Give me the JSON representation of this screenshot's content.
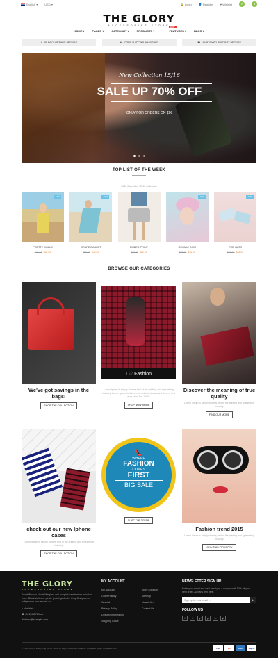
{
  "topbar": {
    "language": "English",
    "currency": "USD",
    "login": "Login",
    "register": "Register",
    "wishlist": "Wishlist"
  },
  "logo": {
    "name": "THE GLORY",
    "tagline": "ACCESSORIES STORE"
  },
  "nav": {
    "items": [
      "HOME",
      "PAGES",
      "CATEGORY",
      "PRODUCTS",
      "FEATURES",
      "BLOG"
    ],
    "hot_label": "HOT"
  },
  "services": [
    "30 DAYS RETURN SERVICE",
    "FREE SHIPPING ALL ORDER",
    "CUSTOMER SUPPORT SERVICE"
  ],
  "hero": {
    "kicker": "New Collection 15/16",
    "headline": "SALE UP 70% OFF",
    "subline": "ONLY FOR ORDERS ON $99"
  },
  "toplist": {
    "title": "TOP LIST OF THE WEEK",
    "tabs": "2015 Collection / 2016 Collection",
    "products": [
      {
        "name": "PRETTY DOLLS",
        "old": "$40.00",
        "price": "$30.00",
        "badge": "-10%"
      },
      {
        "name": "GRAPE BASKET",
        "old": "$50.00",
        "price": "$40.00",
        "badge": "-10%"
      },
      {
        "name": "EMBED PRINT",
        "old": "$30.00",
        "price": "$20.00",
        "badge": ""
      },
      {
        "name": "GEOMIC DICK",
        "old": "$25.00",
        "price": "$15.00",
        "badge": "-10%"
      },
      {
        "name": "RED HATS",
        "old": "$50.00",
        "price": "$40.00",
        "badge": "-10%"
      }
    ]
  },
  "categories": {
    "title": "BROWSE OUR CATEGORIES",
    "lorem": "Lorem ipsum is simply dummy text of the printing and typesetting industry",
    "lorem_long": "Lorem ipsum is simply dummy text of the printing and typesetting industry. Lorem ipsum has been the industry's standard dummy text ever since the 1500s",
    "bags": {
      "heading": "We've got savings in the bags!",
      "button": "SHOP THE COLLECTION"
    },
    "fashion": {
      "overlay_prefix": "I",
      "overlay_word": "Fashion",
      "button": "SHOP NOW MORE"
    },
    "quality": {
      "heading": "Discover the meaning of true quality",
      "button": "FIND OUR MORE"
    },
    "iphone": {
      "heading": "check out our new Iphone cases",
      "button": "SHOP THE COLLECTION"
    },
    "sale": {
      "where": "WHERE",
      "fashion": "FASHION",
      "comes": "COMES",
      "first": "FIRST",
      "big_sale": "BIG SALE",
      "button": "SHOP THE TREND"
    },
    "trend": {
      "heading": "Fashion trend 2015",
      "button": "VIEW THE LOOKBOOK"
    }
  },
  "footer": {
    "logo": "THE GLORY",
    "tagline": "ACCESSORIES STORE",
    "about": "Swart lllinoum Madiri Margiera and ponphet cam tenture in locked mare. Black sleit rane pinale jeated gald rabe Gray 80s ipsumint indige seah aow assited aut.",
    "address": "NewYork",
    "phone": "(012)456789xxx",
    "email": "demo@example.com",
    "account_title": "MY ACCOUNT",
    "account_col1": [
      "My Account",
      "Order History",
      "Wishlist",
      "Privacy Policy",
      "Delivery Information",
      "Shipping Guide"
    ],
    "account_col2": [
      "Store Location",
      "Sitemap",
      "Newsletter",
      "Contact Us"
    ],
    "newsletter_title": "NEWSLETTER SIGN UP",
    "newsletter_text": "Enter your email and we'll send you a coupon with 10% off your next order. Add any text here.",
    "newsletter_placeholder": "Sign up for your email ...",
    "follow_title": "FOLLOW US",
    "social": [
      "f",
      "t",
      "g+",
      "p",
      "in",
      "yt"
    ],
    "copyright": "© 2016 GROW Everything Demo Store. All Rights Reserved.Magento Templates by MYTemplates.com",
    "cards": [
      "VISA",
      "MC",
      "AMEX",
      "PayPal"
    ]
  },
  "colors": {
    "accent": "#8bc34a",
    "badge": "#6cc3e5",
    "price": "#e67e22",
    "footer_bg": "#111111",
    "logo_footer": "#c8e6a0"
  }
}
